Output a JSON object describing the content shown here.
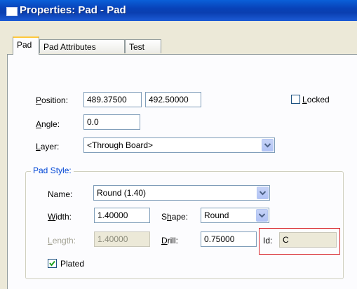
{
  "window": {
    "title": "Properties: Pad - Pad"
  },
  "tabs": [
    {
      "label": "Pad",
      "active": true
    },
    {
      "label": "Pad Attributes",
      "active": false
    },
    {
      "label": "Test",
      "active": false
    }
  ],
  "position": {
    "label_u": "P",
    "label_rest": "osition:",
    "x": "489.37500",
    "y": "492.50000"
  },
  "locked": {
    "label_u": "L",
    "label_rest": "ocked",
    "checked": false
  },
  "angle": {
    "label_u": "A",
    "label_rest": "ngle:",
    "value": "0.0"
  },
  "layer": {
    "label_u": "L",
    "label_rest": "ayer:",
    "value": "<Through Board>"
  },
  "pad_style": {
    "title": "Pad Style:",
    "name": {
      "label": "Name:",
      "value": "Round (1.40)"
    },
    "width": {
      "label_u": "W",
      "label_rest": "idth:",
      "value": "1.40000"
    },
    "shape": {
      "label_a": "S",
      "label_u": "h",
      "label_rest": "ape:",
      "value": "Round"
    },
    "length": {
      "label_u": "L",
      "label_rest": "ength:",
      "value": "1.40000"
    },
    "drill": {
      "label_u": "D",
      "label_rest": "rill:",
      "value": "0.75000"
    },
    "id": {
      "label": "Id:",
      "value": "C"
    },
    "plated": {
      "label": "Plated",
      "checked": true
    }
  }
}
